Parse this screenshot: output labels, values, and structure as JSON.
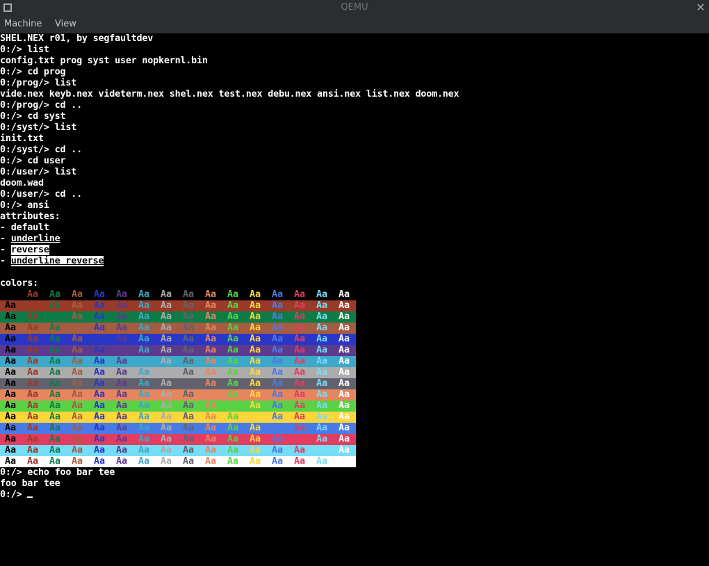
{
  "window": {
    "title": "QEMU"
  },
  "menu": {
    "items": [
      "Machine",
      "View"
    ]
  },
  "terminal": {
    "lines": [
      "SHEL.NEX r01, by segfaultdev",
      "0:/> list",
      "config.txt prog syst user nopkernl.bin",
      "0:/> cd prog",
      "0:/prog/> list",
      "vide.nex keyb.nex videterm.nex shel.nex test.nex debu.nex ansi.nex list.nex doom.nex",
      "0:/prog/> cd ..",
      "0:/> cd syst",
      "0:/syst/> list",
      "init.txt",
      "0:/syst/> cd ..",
      "0:/> cd user",
      "0:/user/> list",
      "doom.wad",
      "0:/user/> cd ..",
      "0:/> ansi",
      "attributes:",
      "- default"
    ],
    "attr_underline": "underline",
    "attr_reverse": "reverse",
    "attr_underline_reverse": "underline reverse",
    "colors_label": "colors:",
    "sample_text": "Aa",
    "after": [
      "0:/> echo foo bar tee",
      "foo bar tee"
    ],
    "prompt": "0:/> "
  },
  "ansi_palette": [
    "#000000",
    "#993b28",
    "#0f7c47",
    "#a55c40",
    "#2a37c6",
    "#5c3a8e",
    "#3da8c8",
    "#acacac",
    "#62626e",
    "#e6865f",
    "#5ad245",
    "#fdd63b",
    "#4a7ae6",
    "#e13d61",
    "#76ddf7",
    "#ffffff"
  ]
}
